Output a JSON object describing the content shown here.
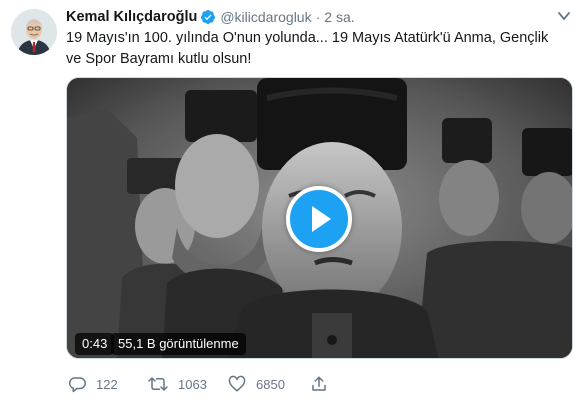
{
  "tweet": {
    "author_name": "Kemal Kılıçdaroğlu",
    "author_handle": "@kilicdarogluk",
    "separator": "·",
    "timestamp": "2 sa.",
    "text": "19 Mayıs'ın 100. yılında O'nun yolunda... 19 Mayıs Atatürk'ü Anma, Gençlik ve Spor Bayramı kutlu olsun!"
  },
  "video": {
    "duration": "0:43",
    "views": "55,1 B görüntülenme"
  },
  "actions": {
    "reply_count": "122",
    "retweet_count": "1063",
    "like_count": "6850"
  },
  "icons": {
    "verified": "verified-badge-icon",
    "caret": "chevron-down-icon",
    "play": "play-icon",
    "reply": "reply-icon",
    "retweet": "retweet-icon",
    "like": "heart-icon",
    "share": "share-icon"
  },
  "colors": {
    "accent": "#1da1f2",
    "muted": "#657786",
    "text": "#14171a"
  }
}
